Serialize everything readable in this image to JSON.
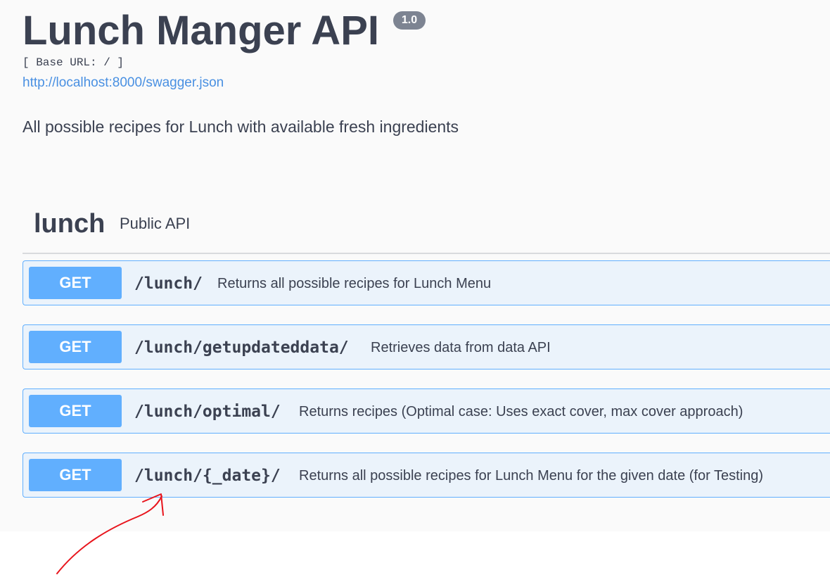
{
  "api": {
    "title": "Lunch Manger API",
    "version": "1.0",
    "base_url": "[ Base URL: / ]",
    "spec_link": "http://localhost:8000/swagger.json",
    "description": "All possible recipes for Lunch with available fresh ingredients"
  },
  "tag": {
    "name": "lunch",
    "description": "Public API"
  },
  "operations": [
    {
      "method": "GET",
      "path": "/lunch/",
      "summary": "Returns all possible recipes for Lunch Menu"
    },
    {
      "method": "GET",
      "path": "/lunch/getupdateddata/",
      "summary": "Retrieves data from data API"
    },
    {
      "method": "GET",
      "path": "/lunch/optimal/",
      "summary": "Returns recipes (Optimal case: Uses exact cover, max cover approach)"
    },
    {
      "method": "GET",
      "path": "/lunch/{_date}/",
      "summary": "Returns all possible recipes for Lunch Menu for the given date (for Testing)"
    }
  ],
  "colors": {
    "get_accent": "#61affe",
    "get_background": "#ebf3fb",
    "text": "#3b4151",
    "link": "#4990e2",
    "annotation": "#e8141c"
  }
}
